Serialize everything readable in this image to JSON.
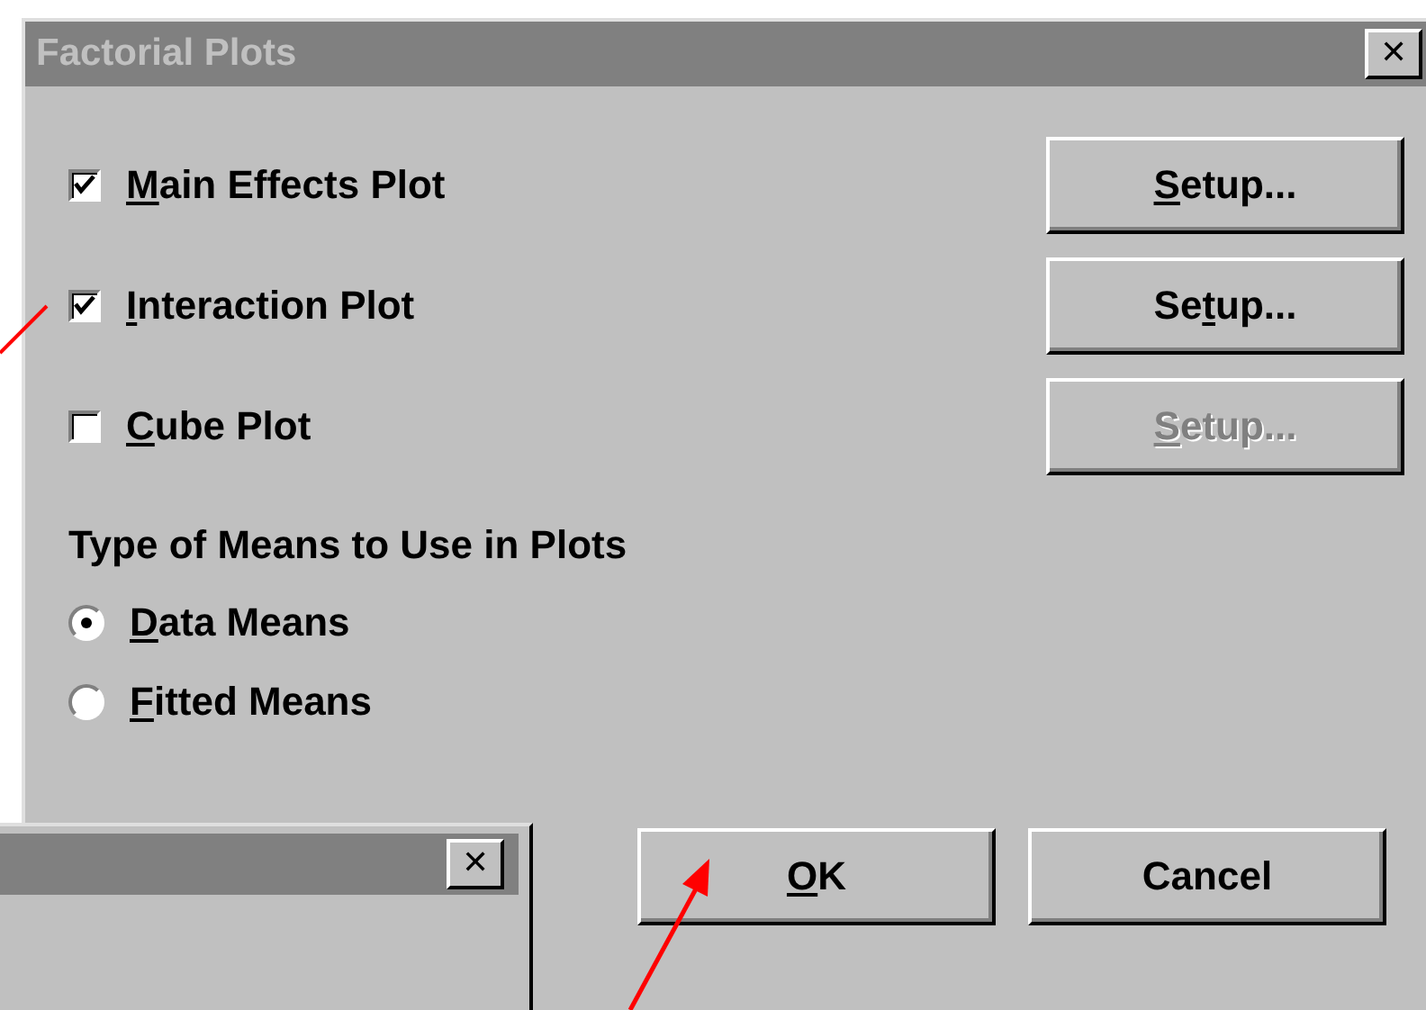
{
  "window": {
    "title": "Factorial Plots",
    "close": "✕"
  },
  "plots": [
    {
      "label": [
        {
          "text": "M",
          "underlined": true
        },
        {
          "text": "ain Effects Plot",
          "underlined": false
        }
      ],
      "checked": true,
      "setup": {
        "label": [
          {
            "text": "S",
            "underlined": true
          },
          {
            "text": "etup...",
            "underlined": false
          }
        ],
        "disabled": false
      }
    },
    {
      "label": [
        {
          "text": "I",
          "underlined": true
        },
        {
          "text": "nteraction Plot",
          "underlined": false
        }
      ],
      "checked": true,
      "setup": {
        "label": [
          {
            "text": "Se",
            "underlined": false
          },
          {
            "text": "t",
            "underlined": true
          },
          {
            "text": "up...",
            "underlined": false
          }
        ],
        "disabled": false
      }
    },
    {
      "label": [
        {
          "text": "C",
          "underlined": true
        },
        {
          "text": "ube Plot",
          "underlined": false
        }
      ],
      "checked": false,
      "setup": {
        "label": [
          {
            "text": "S",
            "underlined": true
          },
          {
            "text": "etup...",
            "underlined": false
          }
        ],
        "disabled": true
      }
    }
  ],
  "means": {
    "heading": "Type of Means to Use in Plots",
    "options": [
      {
        "label": [
          {
            "text": "D",
            "underlined": true
          },
          {
            "text": "ata Means",
            "underlined": false
          }
        ],
        "selected": true
      },
      {
        "label": [
          {
            "text": "F",
            "underlined": true
          },
          {
            "text": "itted Means",
            "underlined": false
          }
        ],
        "selected": false
      }
    ]
  },
  "buttons": [
    {
      "label": [
        {
          "text": "O",
          "underlined": true
        },
        {
          "text": "K",
          "underlined": false
        }
      ]
    },
    {
      "label": [
        {
          "text": "Cancel",
          "underlined": false
        }
      ]
    }
  ],
  "background_window": {
    "close": "✕"
  }
}
